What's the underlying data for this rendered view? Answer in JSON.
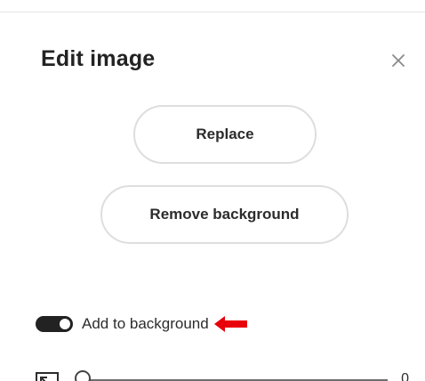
{
  "panel": {
    "title": "Edit image",
    "close_icon": "close-icon"
  },
  "actions": {
    "replace_label": "Replace",
    "remove_background_label": "Remove background"
  },
  "background_toggle": {
    "label": "Add to background",
    "checked": true,
    "annotation_icon": "red-arrow-left-icon",
    "annotation_color": "#e8000b"
  },
  "slider": {
    "icon": "resize-icon",
    "value": "0",
    "level": 0
  },
  "colors": {
    "toggle_on": "#222222",
    "button_border": "#dedede",
    "text": "#2c2c2c"
  }
}
